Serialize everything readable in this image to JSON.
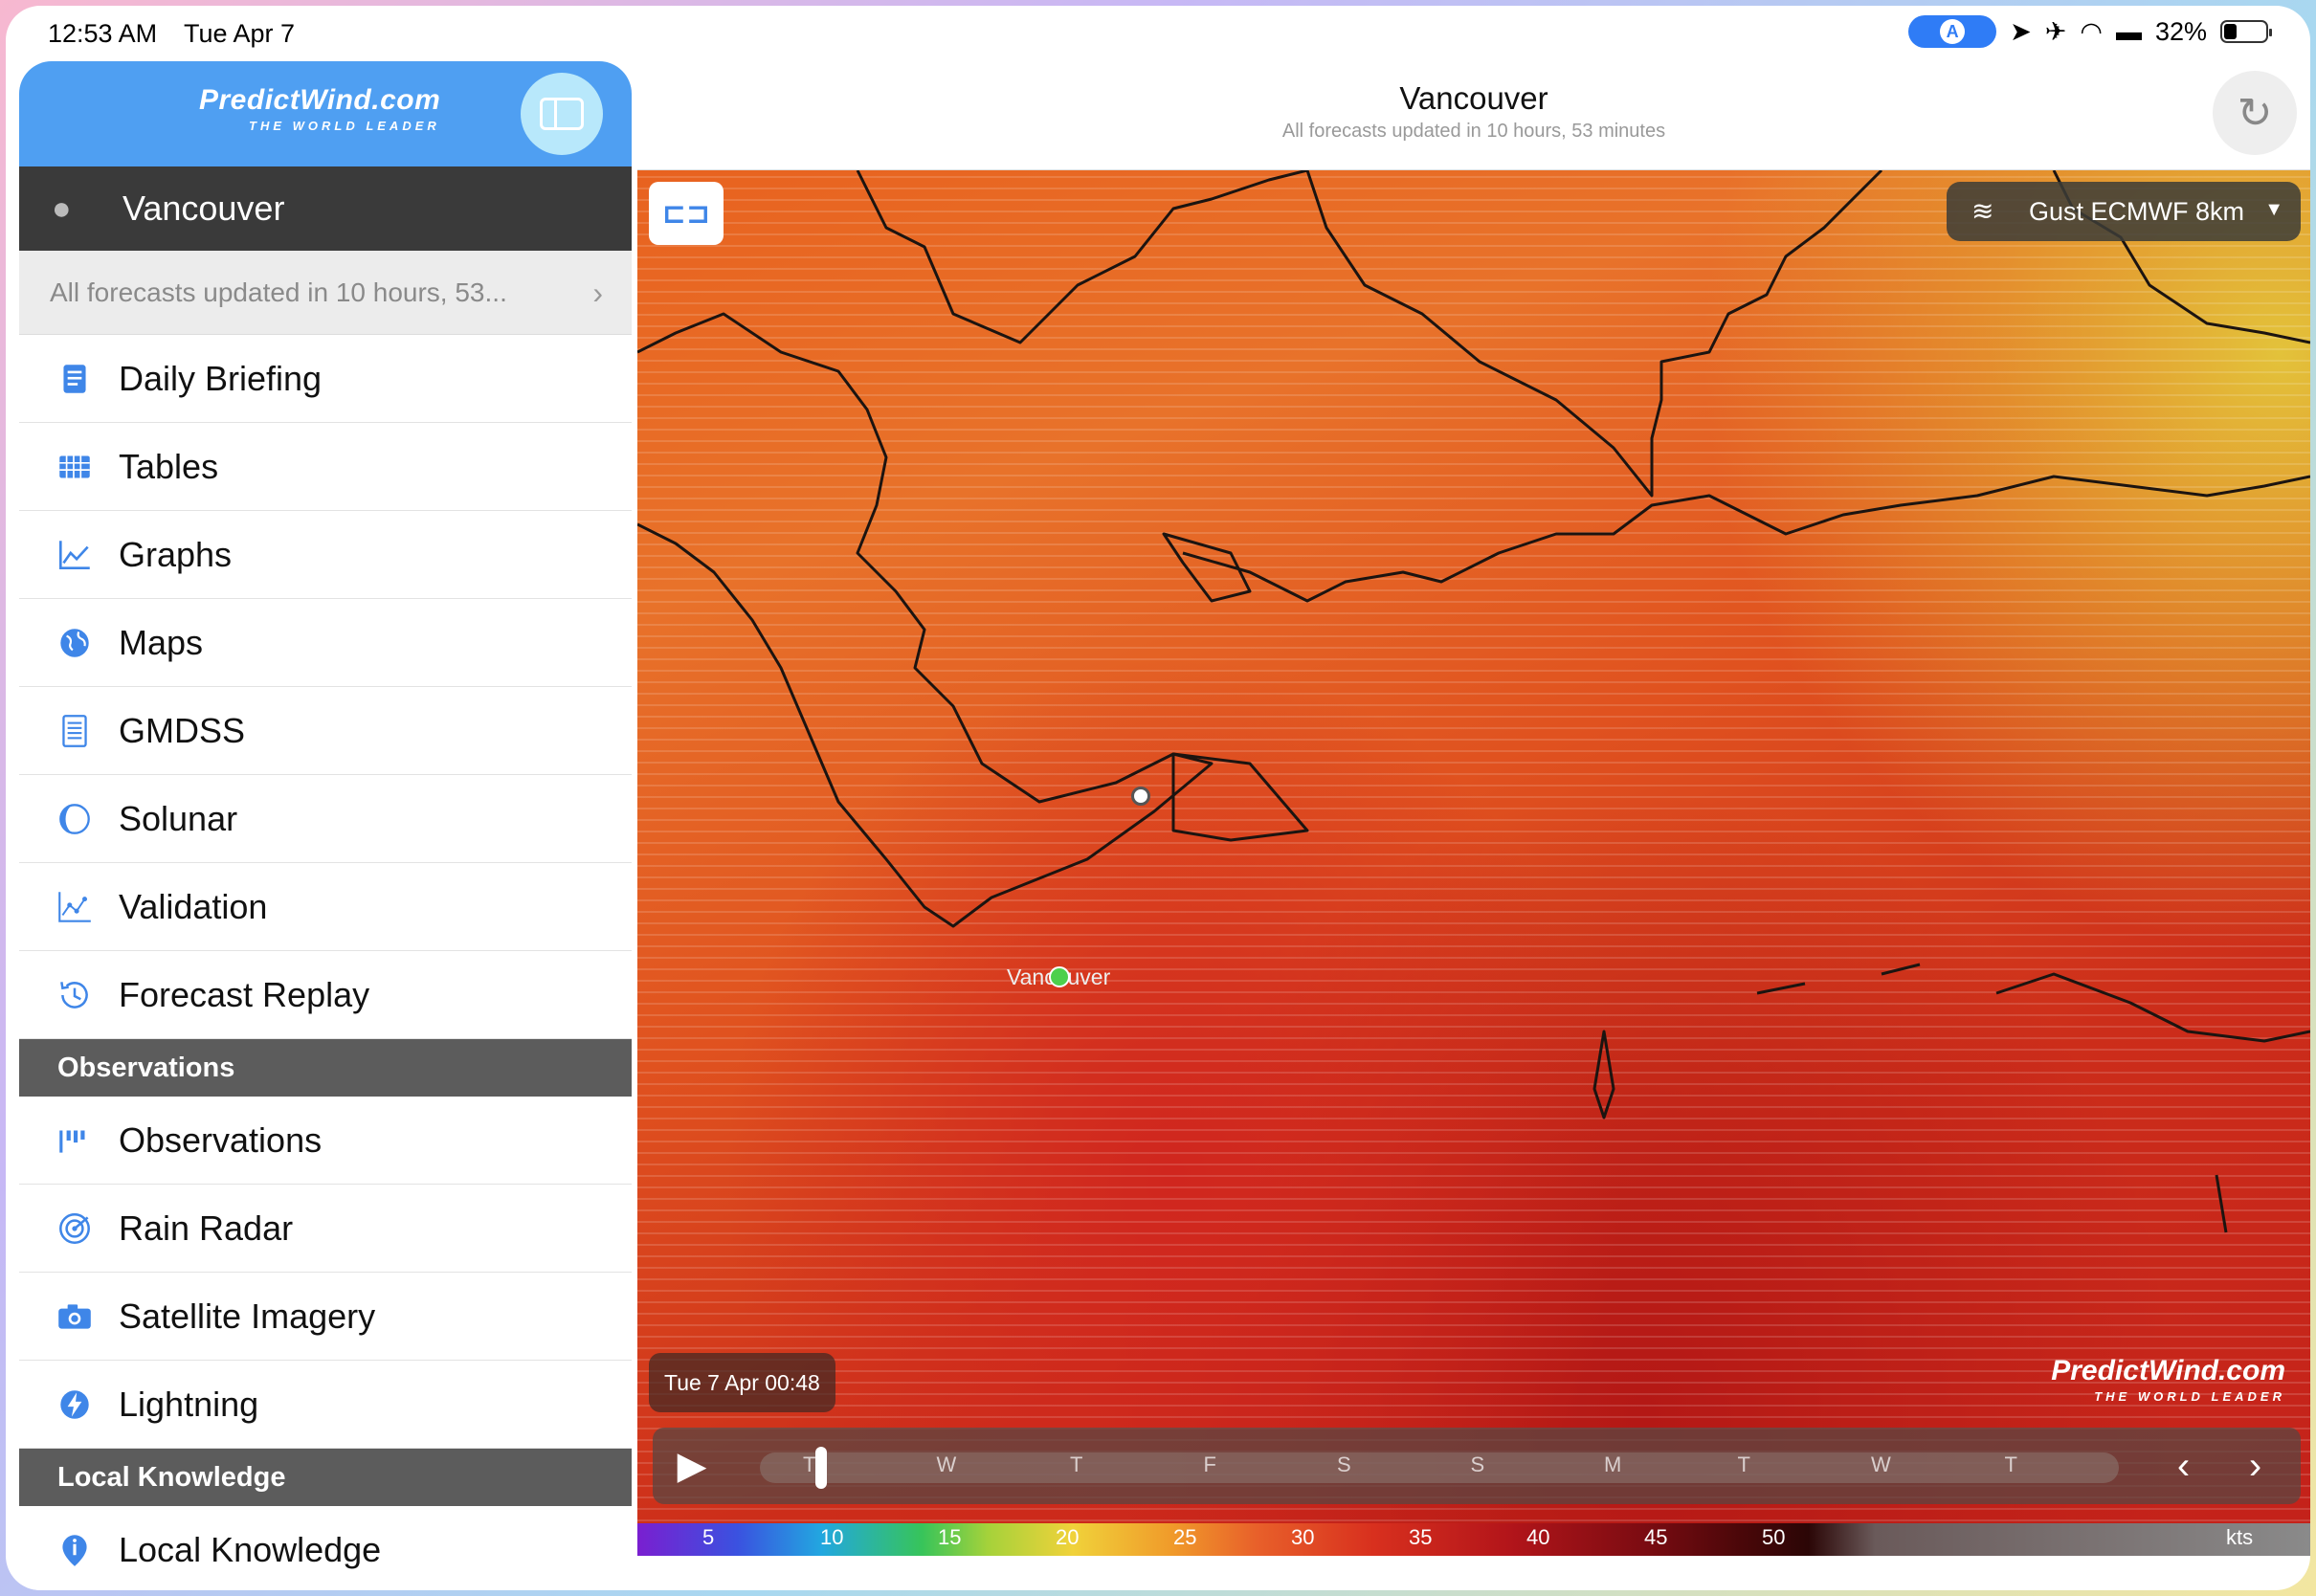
{
  "status": {
    "time": "12:53 AM",
    "date": "Tue Apr 7",
    "battery": "32%"
  },
  "brand": {
    "name": "PredictWind.com",
    "tagline": "THE WORLD LEADER"
  },
  "location": "Vancouver",
  "updated": "All forecasts updated in 10 hours, 53...",
  "header": {
    "title": "Vancouver",
    "subtitle": "All forecasts updated in 10 hours, 53 minutes"
  },
  "menu": [
    {
      "label": "Daily Briefing",
      "icon": "document-icon"
    },
    {
      "label": "Tables",
      "icon": "grid-icon"
    },
    {
      "label": "Graphs",
      "icon": "line-chart-icon"
    },
    {
      "label": "Maps",
      "icon": "globe-icon"
    },
    {
      "label": "GMDSS",
      "icon": "list-icon"
    },
    {
      "label": "Solunar",
      "icon": "moon-icon"
    },
    {
      "label": "Validation",
      "icon": "scatter-icon"
    },
    {
      "label": "Forecast Replay",
      "icon": "history-icon"
    }
  ],
  "sections": {
    "observations": "Observations",
    "local_knowledge": "Local Knowledge"
  },
  "observations": [
    {
      "label": "Observations",
      "icon": "bars-icon"
    },
    {
      "label": "Rain Radar",
      "icon": "radar-icon"
    },
    {
      "label": "Satellite Imagery",
      "icon": "camera-icon"
    },
    {
      "label": "Lightning",
      "icon": "bolt-icon"
    }
  ],
  "local_knowledge": [
    {
      "label": "Local Knowledge",
      "icon": "info-icon"
    }
  ],
  "map": {
    "model": "Gust ECMWF 8km",
    "place": "Vancouver",
    "timestamp": "Tue 7 Apr 00:48",
    "timeline_days": [
      "T",
      "W",
      "T",
      "F",
      "S",
      "S",
      "M",
      "T",
      "W",
      "T"
    ],
    "timeline_position": 0.02,
    "scale_values": [
      "5",
      "10",
      "15",
      "20",
      "25",
      "30",
      "35",
      "40",
      "45",
      "50"
    ],
    "scale_unit": "kts"
  }
}
